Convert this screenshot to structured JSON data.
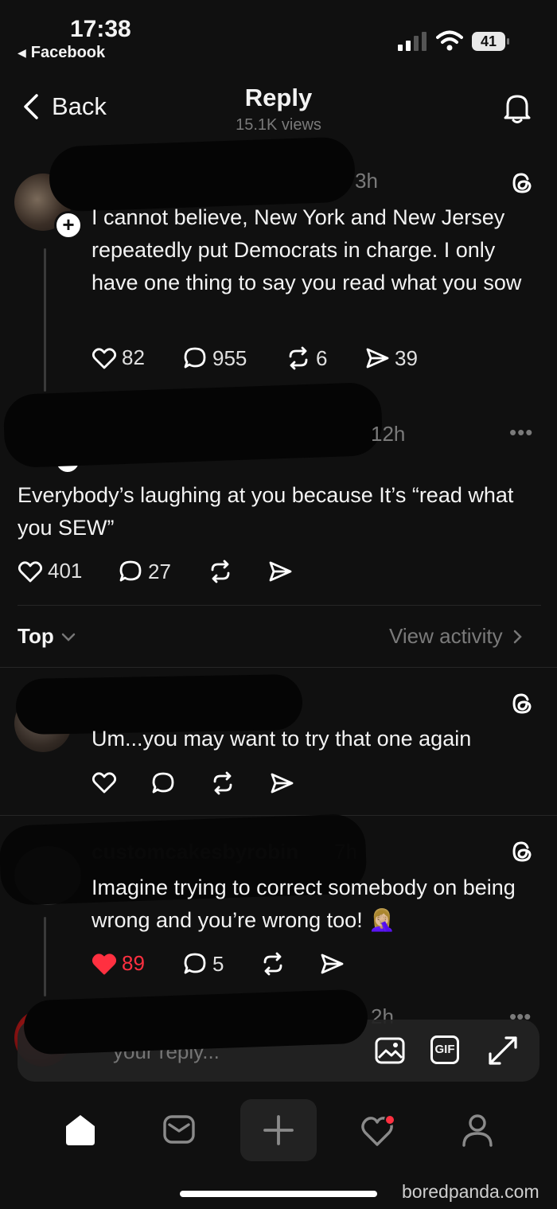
{
  "status_bar": {
    "time": "17:38",
    "back_app": "Facebook",
    "battery": "41"
  },
  "nav": {
    "back_label": "Back",
    "title": "Reply",
    "views": "15.1K views"
  },
  "root_post": {
    "time": "3h",
    "text": "I cannot believe, New York and New Jersey repeatedly put Democrats in charge. I only have one thing to say you read what you sow",
    "likes": "82",
    "replies": "955",
    "reposts": "6",
    "shares": "39"
  },
  "main_reply": {
    "time": "12h",
    "text": "Everybody’s laughing at you because It’s “read what you SEW”",
    "likes": "401",
    "replies": "27"
  },
  "sort": {
    "label": "Top",
    "view_activity": "View activity"
  },
  "comment1": {
    "text": "Um...you may want to try that one again"
  },
  "comment2": {
    "username": "customcakesbyrobin",
    "time": "7h",
    "text": "Imagine trying to correct somebody on being wrong and you’re wrong too! 🤦🏼‍♀️",
    "likes": "89",
    "replies": "5"
  },
  "comment3": {
    "time": "2h"
  },
  "composer": {
    "placeholder": "your reply...",
    "gif_label": "GIF"
  },
  "watermark": "boredpanda.com",
  "colors": {
    "like_red": "#ff3040",
    "background": "#101010"
  }
}
